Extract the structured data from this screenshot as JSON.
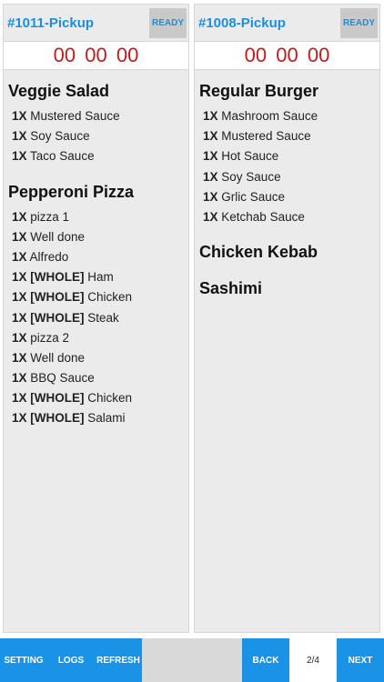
{
  "orders": [
    {
      "id": "#1011-Pickup",
      "ready_label": "READY",
      "timer": [
        "00",
        "00",
        "00"
      ],
      "items": [
        {
          "name": "Veggie Salad",
          "mods": [
            {
              "qty": "1X",
              "tag": "",
              "text": "Mustered Sauce"
            },
            {
              "qty": "1X",
              "tag": "",
              "text": "Soy Sauce"
            },
            {
              "qty": "1X",
              "tag": "",
              "text": "Taco Sauce"
            }
          ]
        },
        {
          "name": "Pepperoni Pizza",
          "mods": [
            {
              "qty": "1X",
              "tag": "",
              "text": "pizza 1"
            },
            {
              "qty": "1X",
              "tag": "",
              "text": "Well done"
            },
            {
              "qty": "1X",
              "tag": "",
              "text": " Alfredo"
            },
            {
              "qty": "1X",
              "tag": "[WHOLE]",
              "text": " Ham"
            },
            {
              "qty": "1X",
              "tag": "[WHOLE]",
              "text": "Chicken"
            },
            {
              "qty": "1X",
              "tag": "[WHOLE]",
              "text": "Steak"
            },
            {
              "qty": "1X",
              "tag": "",
              "text": "pizza 2"
            },
            {
              "qty": "1X",
              "tag": "",
              "text": "Well done"
            },
            {
              "qty": "1X",
              "tag": "",
              "text": " BBQ Sauce"
            },
            {
              "qty": "1X",
              "tag": "[WHOLE]",
              "text": "Chicken"
            },
            {
              "qty": "1X",
              "tag": "[WHOLE]",
              "text": " Salami"
            }
          ]
        }
      ]
    },
    {
      "id": "#1008-Pickup",
      "ready_label": "READY",
      "timer": [
        "00",
        "00",
        "00"
      ],
      "items": [
        {
          "name": "Regular Burger",
          "mods": [
            {
              "qty": "1X",
              "tag": "",
              "text": "Mashroom Sauce"
            },
            {
              "qty": "1X",
              "tag": "",
              "text": "Mustered Sauce"
            },
            {
              "qty": "1X",
              "tag": "",
              "text": "Hot Sauce"
            },
            {
              "qty": "1X",
              "tag": "",
              "text": "Soy Sauce"
            },
            {
              "qty": "1X",
              "tag": "",
              "text": "Grlic Sauce"
            },
            {
              "qty": "1X",
              "tag": "",
              "text": "Ketchab Sauce"
            }
          ]
        },
        {
          "name": "Chicken Kebab",
          "mods": []
        },
        {
          "name": "Sashimi",
          "mods": []
        }
      ]
    }
  ],
  "toolbar": {
    "setting_label": "SETTING",
    "logs_label": "LOGS",
    "refresh_label": "REFRESH",
    "back_label": "BACK",
    "page_indicator": "2/4",
    "next_label": "NEXT"
  },
  "colors": {
    "accent": "#1a93e6",
    "order_id": "#1a8fe0",
    "timer": "#c41a1a",
    "card_bg": "#ebebeb"
  }
}
